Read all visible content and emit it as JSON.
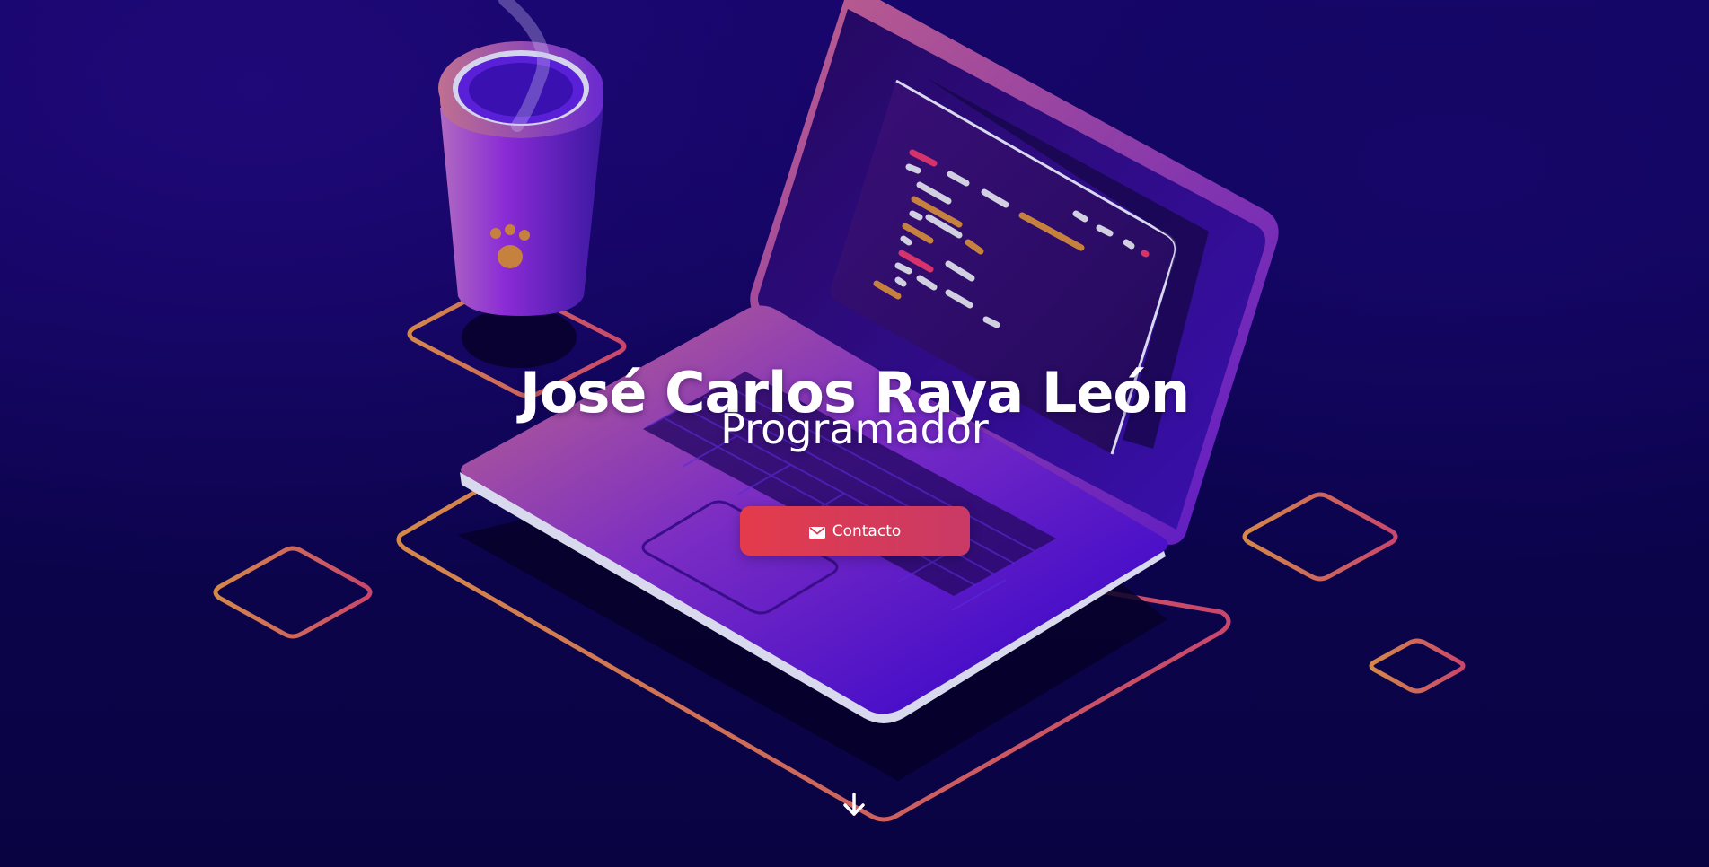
{
  "hero": {
    "name": "José Carlos Raya León",
    "role": "Programador",
    "contact_button": {
      "label": "Contacto",
      "icon": "envelope-icon"
    },
    "scroll_icon": "arrow-down-icon"
  },
  "colors": {
    "background": "#0c0450",
    "accent_orange": "#d4884a",
    "accent_pink": "#c9466c",
    "button": "#e0404f",
    "laptop_purple": "#5b16c9",
    "text": "#ffffff"
  }
}
